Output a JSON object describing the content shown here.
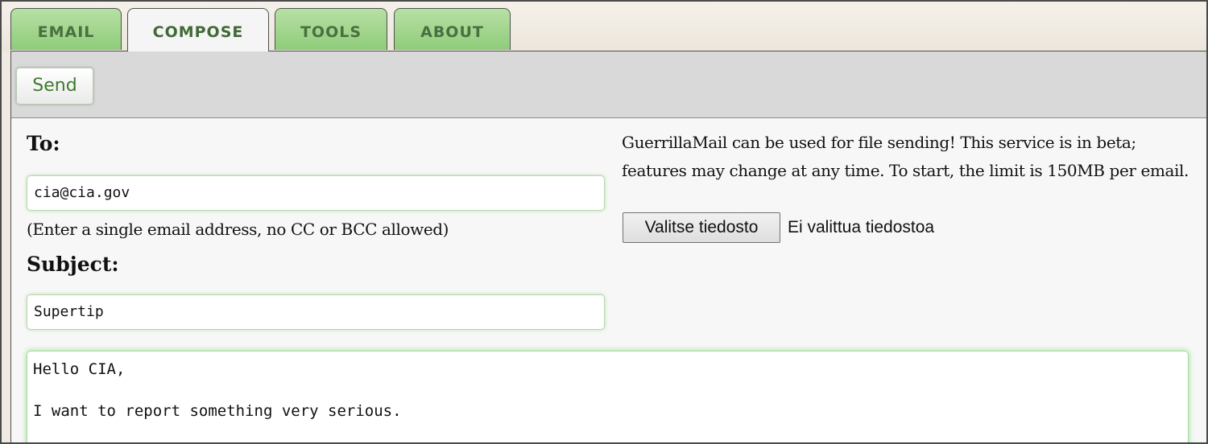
{
  "tabs": [
    {
      "label": "EMAIL",
      "active": false
    },
    {
      "label": "COMPOSE",
      "active": true
    },
    {
      "label": "TOOLS",
      "active": false
    },
    {
      "label": "ABOUT",
      "active": false
    }
  ],
  "toolbar": {
    "send_label": "Send"
  },
  "compose": {
    "to_label": "To:",
    "to_value": "cia@cia.gov",
    "to_hint": "(Enter a single email address, no CC or BCC allowed)",
    "subject_label": "Subject:",
    "subject_value": "Supertip",
    "body_text": "Hello CIA,\n\nI want to report something very serious."
  },
  "attachment": {
    "info_text": "GuerrillaMail can be used for file sending! This service is in beta; features may change at any time. To start, the limit is 150MB per email.",
    "choose_button_label": "Valitse tiedosto",
    "file_status": "Ei valittua tiedostoa"
  },
  "colors": {
    "tab_green": "#8fcc7a",
    "tab_text": "#4a7040",
    "send_text": "#3c7a2c",
    "toolbar_bg": "#d9d9d9",
    "focus_glow": "#5ad250"
  }
}
